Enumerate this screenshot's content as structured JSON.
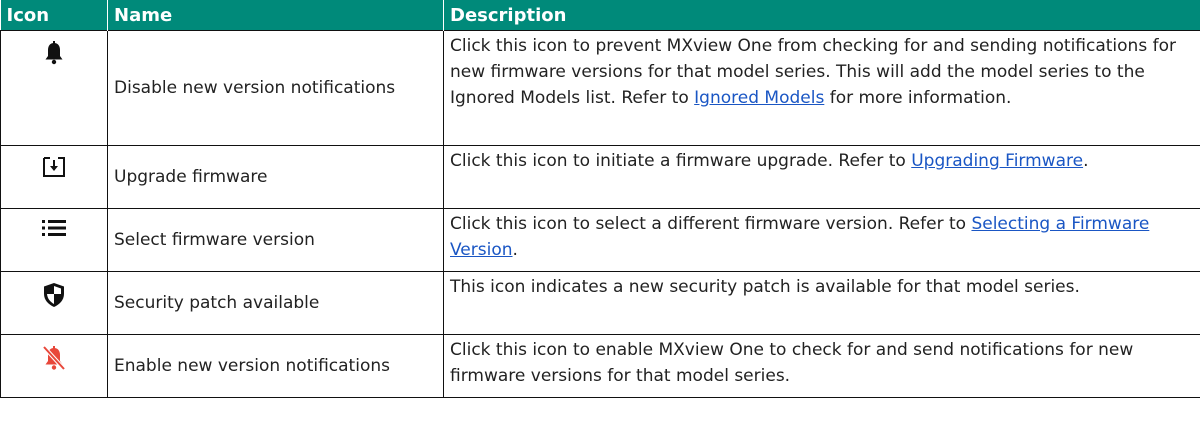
{
  "header": {
    "icon": "Icon",
    "name": "Name",
    "description": "Description"
  },
  "rows": [
    {
      "icon": "bell-icon",
      "name": "Disable new version notifications",
      "desc_before": "Click this icon to prevent MXview One from checking for and sending notifications for new firmware versions for that model series. This will add the model series to the Ignored Models list. Refer to ",
      "link": "Ignored Models",
      "desc_after": " for more information."
    },
    {
      "icon": "download-box-icon",
      "name": "Upgrade firmware",
      "desc_before": "Click this icon to initiate a firmware upgrade. Refer to ",
      "link": "Upgrading Firmware",
      "desc_after": "."
    },
    {
      "icon": "list-icon",
      "name": "Select firmware version",
      "desc_before": "Click this icon to select a different firmware version. Refer to ",
      "link": "Selecting a Firmware Version",
      "desc_after": "."
    },
    {
      "icon": "shield-icon",
      "name": "Security patch available",
      "desc_before": "This icon indicates a new security patch is available for that model series.",
      "link": "",
      "desc_after": ""
    },
    {
      "icon": "bell-off-icon",
      "name": "Enable new version notifications",
      "desc_before": "Click this icon to enable MXview One to check for and send notifications for new firmware versions for that model series.",
      "link": "",
      "desc_after": ""
    }
  ],
  "colors": {
    "header_bg": "#008a7a",
    "link": "#1a56c4",
    "bell_off": "#e8473a"
  }
}
